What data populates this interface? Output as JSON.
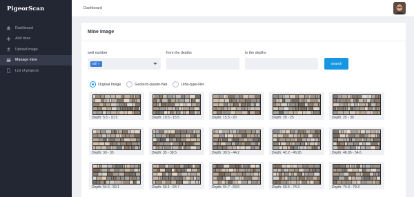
{
  "brand": "PigeorScan",
  "sidebar": {
    "items": [
      {
        "label": "Dashboard",
        "icon": "home-icon",
        "active": false
      },
      {
        "label": "Add mine",
        "icon": "plus-icon",
        "active": false
      },
      {
        "label": "Upload image",
        "icon": "upload-icon",
        "active": false
      },
      {
        "label": "Manage mine",
        "icon": "list-icon",
        "active": true
      },
      {
        "label": "List of projects",
        "icon": "document-icon",
        "active": false
      }
    ]
  },
  "topbar": {
    "breadcrumb": "Dashboard"
  },
  "card": {
    "title": "Mine Image",
    "well_label": "well number",
    "well_tag": "Bill",
    "from_label": "from the depths",
    "to_label": "to the depths",
    "from_value": "",
    "to_value": "",
    "search_label": "search"
  },
  "radios": [
    {
      "label": "Orginal Image",
      "checked": true
    },
    {
      "label": "Geotech-param-Net",
      "checked": false
    },
    {
      "label": "Litho-type-Net",
      "checked": false
    }
  ],
  "images": [
    {
      "label": "Depth: 5.5 - 10.5"
    },
    {
      "label": "Depth: 10.5 - 15.5"
    },
    {
      "label": "Depth: 15.5 - 20"
    },
    {
      "label": "Depth: 20 - 25"
    },
    {
      "label": "Depth: 25 - 30"
    },
    {
      "label": "Depth: 30 - 35"
    },
    {
      "label": "Depth: 35 - 39.5"
    },
    {
      "label": "Depth: 39.5 - 44.2"
    },
    {
      "label": "Depth: 42.2 - 46.95"
    },
    {
      "label": "Depth: 46.95 - 54.6"
    },
    {
      "label": "Depth: 54.6 - 59.1"
    },
    {
      "label": "Depth: 59.1 - 64.7"
    },
    {
      "label": "Depth: 64.7 - 69.5"
    },
    {
      "label": "Depth: 69.5 - 74.3"
    },
    {
      "label": "Depth: 74.3 - 79.3"
    }
  ],
  "colors": {
    "accent": "#1796e3",
    "sidebar": "#232733",
    "tag": "#3a7bd5"
  }
}
